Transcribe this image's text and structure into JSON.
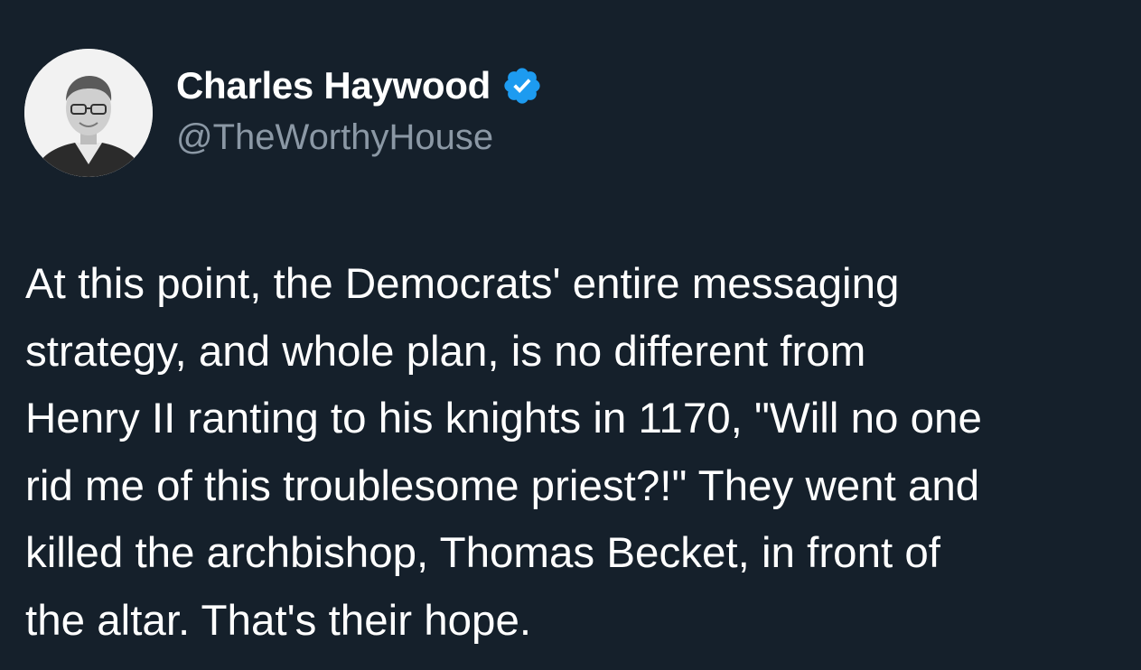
{
  "tweet": {
    "author": {
      "display_name": "Charles Haywood",
      "handle": "@TheWorthyHouse",
      "verified_icon": "verified-badge-icon",
      "badge_color": "#1d9bf0"
    },
    "text_lines": [
      "At this point, the Democrats' entire messaging",
      "strategy, and whole plan, is no different from",
      "Henry II ranting to his knights in 1170, \"Will no one",
      "rid me of this troublesome priest?!\" They went and",
      "killed the archbishop, Thomas Becket, in front of",
      "the altar. That's their hope."
    ]
  },
  "colors": {
    "background": "#15202b",
    "text_primary": "#ffffff",
    "text_secondary": "#8b98a5"
  }
}
